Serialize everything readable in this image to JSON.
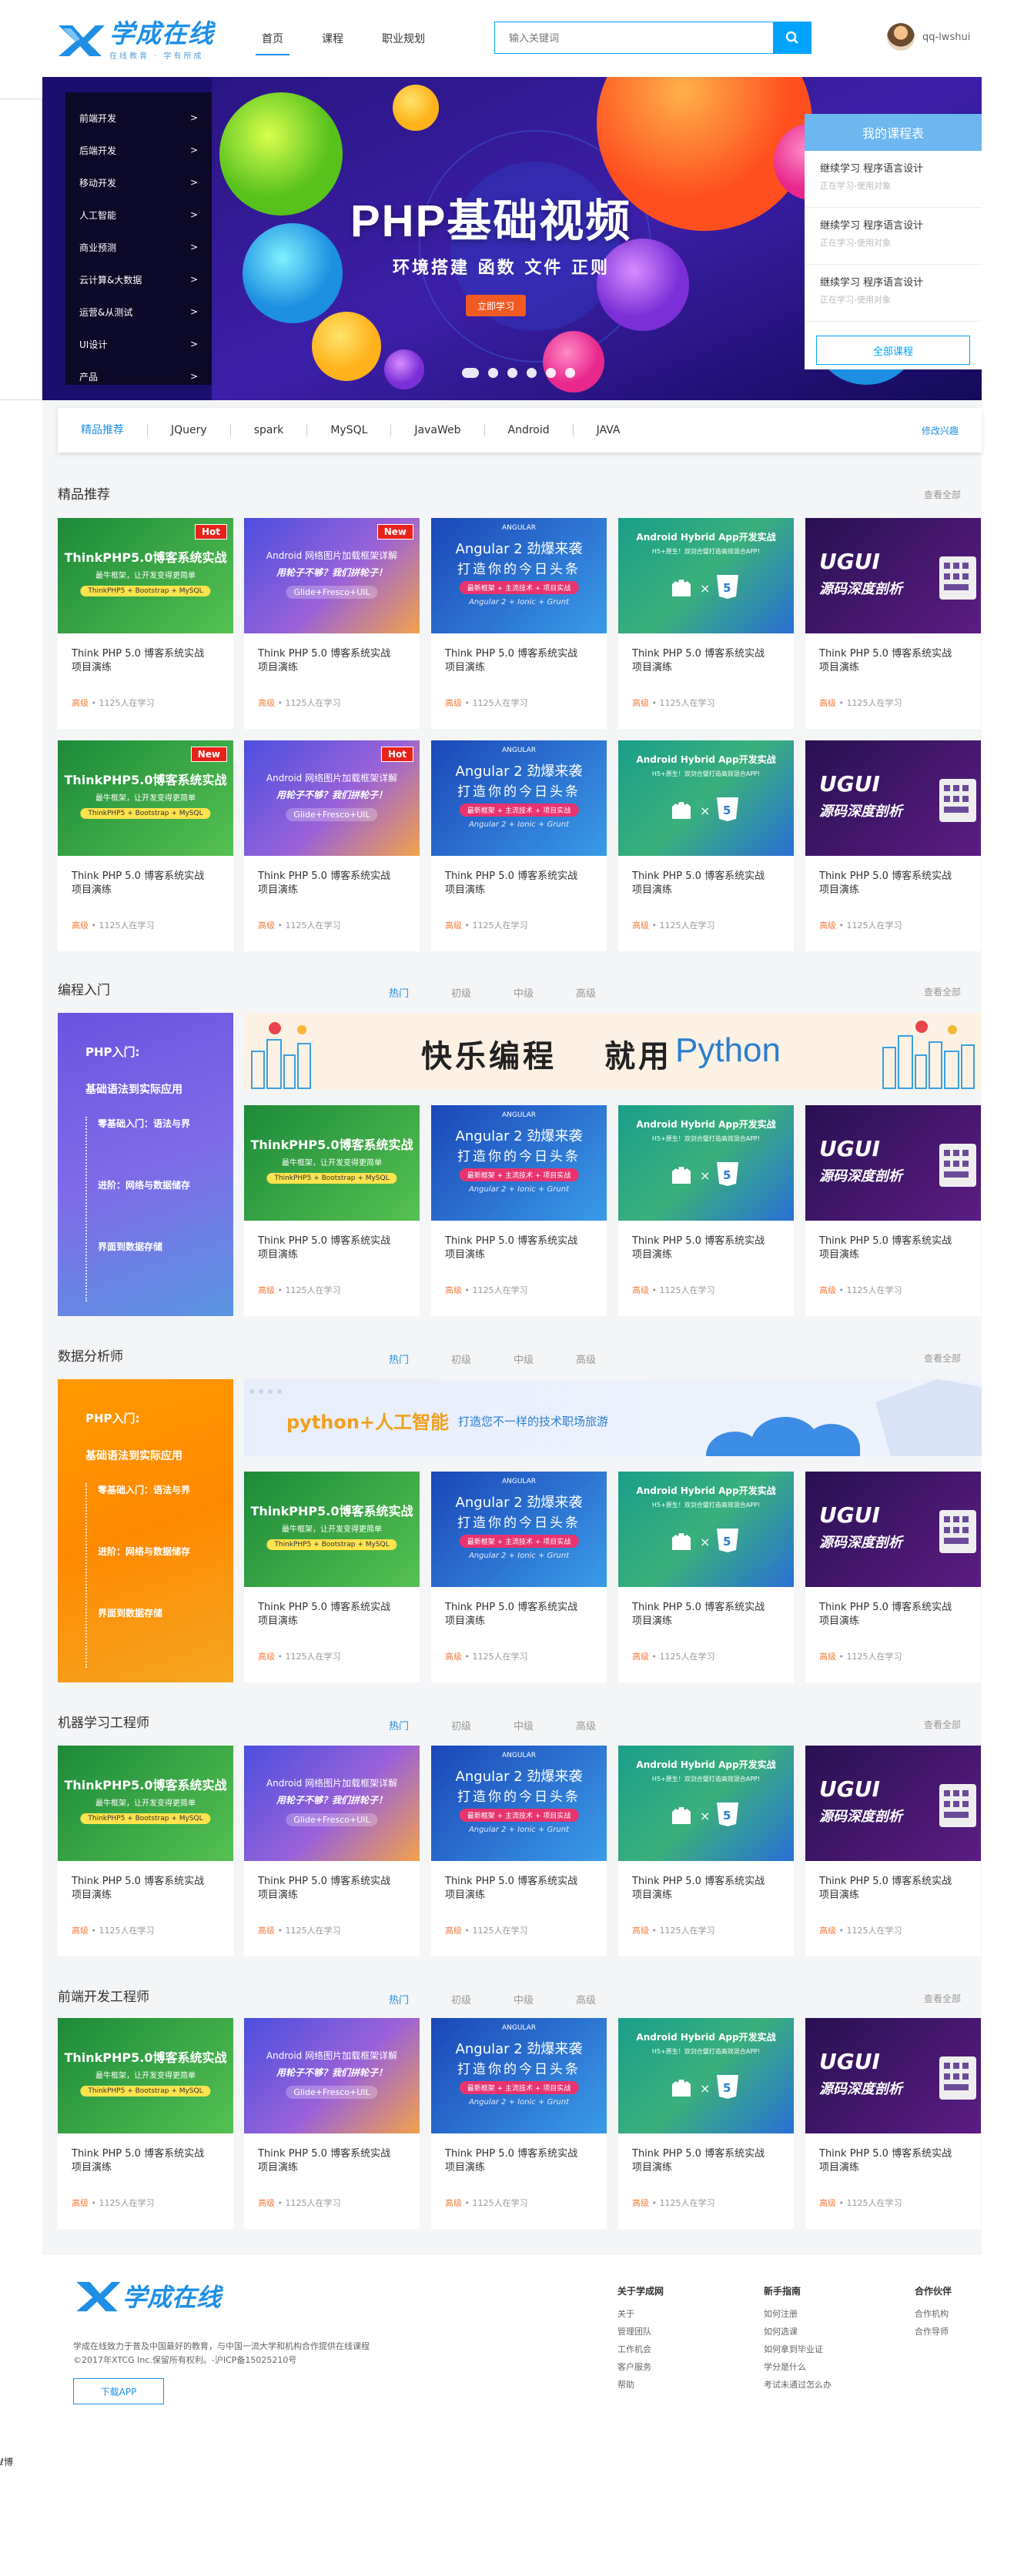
{
  "header": {
    "logo_title": "学成在线",
    "logo_sub": "在线教育 · 学有所成",
    "nav": [
      "首页",
      "课程",
      "职业规划"
    ],
    "search_placeholder": "输入关键词",
    "username": "qq-lwshui"
  },
  "banner": {
    "side_menu": [
      "前端开发",
      "后端开发",
      "移动开发",
      "人工智能",
      "商业预测",
      "云计算&大数据",
      "运营&从测试",
      "UI设计",
      "产品"
    ],
    "arrow": ">",
    "title": "PHP基础视频",
    "subtitle": "环境搭建  函数  文件  正则",
    "button": "立即学习",
    "my_courses": {
      "heading": "我的课程表",
      "items": [
        {
          "title": "继续学习 程序语言设计",
          "sub": "正在学习-使用对象"
        },
        {
          "title": "继续学习 程序语言设计",
          "sub": "正在学习-使用对象"
        },
        {
          "title": "继续学习 程序语言设计",
          "sub": "正在学习-使用对象"
        }
      ],
      "all_button": "全部课程"
    }
  },
  "category_tabs": {
    "items": [
      "精品推荐",
      "JQuery",
      "spark",
      "MySQL",
      "JavaWeb",
      "Android",
      "JAVA"
    ],
    "more": "修改兴趣"
  },
  "card_common": {
    "title_line1": "Think PHP 5.0 博客系统实战",
    "title_line2": "项目演练",
    "level": "高级",
    "learners": " • 1125人在学习"
  },
  "thumbs": {
    "t1_title": "ThinkPHP5.0博客系统实战",
    "t1_sub": "最牛框架，让开发变得更简单",
    "t1_pill": "ThinkPHP5 + Bootstrap + MySQL",
    "t2_title": "Android 网络图片加载框架详解",
    "t2_sub": "用轮子不够？我们拼轮子！",
    "t2_pill": "Glide+Fresco+UIL",
    "t3_tag": "ANGULAR",
    "t3_title": "Angular 2 劲爆来袭",
    "t3_sub": "打造你的今日头条",
    "t3_pill": "最新框架 + 主流技术 + 项目实战",
    "t3_foot": "Angular 2 + Ionic + Grunt",
    "t4_title": "Android Hybrid App开发实战",
    "t4_sub": "H5+原生！双剑合璧打造高效混合APP!",
    "t5_title": "UGUI",
    "t5_sub": "源码深度剖析"
  },
  "badges": {
    "hot": "Hot",
    "new": "New"
  },
  "sections": {
    "featured": {
      "title": "精品推荐",
      "more": "查看全部"
    },
    "programming": {
      "title": "编程入门",
      "tabs": [
        "热门",
        "初级",
        "中级",
        "高级"
      ],
      "more": "查看全部"
    },
    "data_analyst": {
      "title": "数据分析师",
      "tabs": [
        "热门",
        "初级",
        "中级",
        "高级"
      ],
      "more": "查看全部"
    },
    "ml_engineer": {
      "title": "机器学习工程师",
      "tabs": [
        "热门",
        "初级",
        "中级",
        "高级"
      ],
      "more": "查看全部"
    },
    "frontend_engineer": {
      "title": "前端开发工程师",
      "tabs": [
        "热门",
        "初级",
        "中级",
        "高级"
      ],
      "more": "查看全部"
    }
  },
  "promo": {
    "title": "PHP入门:",
    "sub": "基础语法到实际应用",
    "steps": [
      "零基础入门：语法与界",
      "进阶：网络与数据储存",
      "界面到数据存储"
    ]
  },
  "python_banner": {
    "left": "快乐编程",
    "right_cn": "就用",
    "right_en": "Python"
  },
  "ai_banner": {
    "main": "python+人工智能",
    "sub": "打造您不一样的技术职场旅游"
  },
  "footer": {
    "desc_line1": "学成在线致力于普及中国最好的教育，与中国一流大学和机构合作提供在线课程",
    "desc_line2": "©2017年XTCG Inc.保留所有权利。-沪ICP备15025210号",
    "download": "下载APP",
    "col1": {
      "head": "关于学成网",
      "items": [
        "关于",
        "管理团队",
        "工作机会",
        "客户服务",
        "帮助"
      ]
    },
    "col2": {
      "head": "新手指南",
      "items": [
        "如何注册",
        "如何选课",
        "如何拿到毕业证",
        "学分是什么",
        "考试未通过怎么办"
      ]
    },
    "col3": {
      "head": "合作伙伴",
      "items": [
        "合作机构",
        "合作导师"
      ]
    }
  },
  "corner_text": "ℓ博"
}
